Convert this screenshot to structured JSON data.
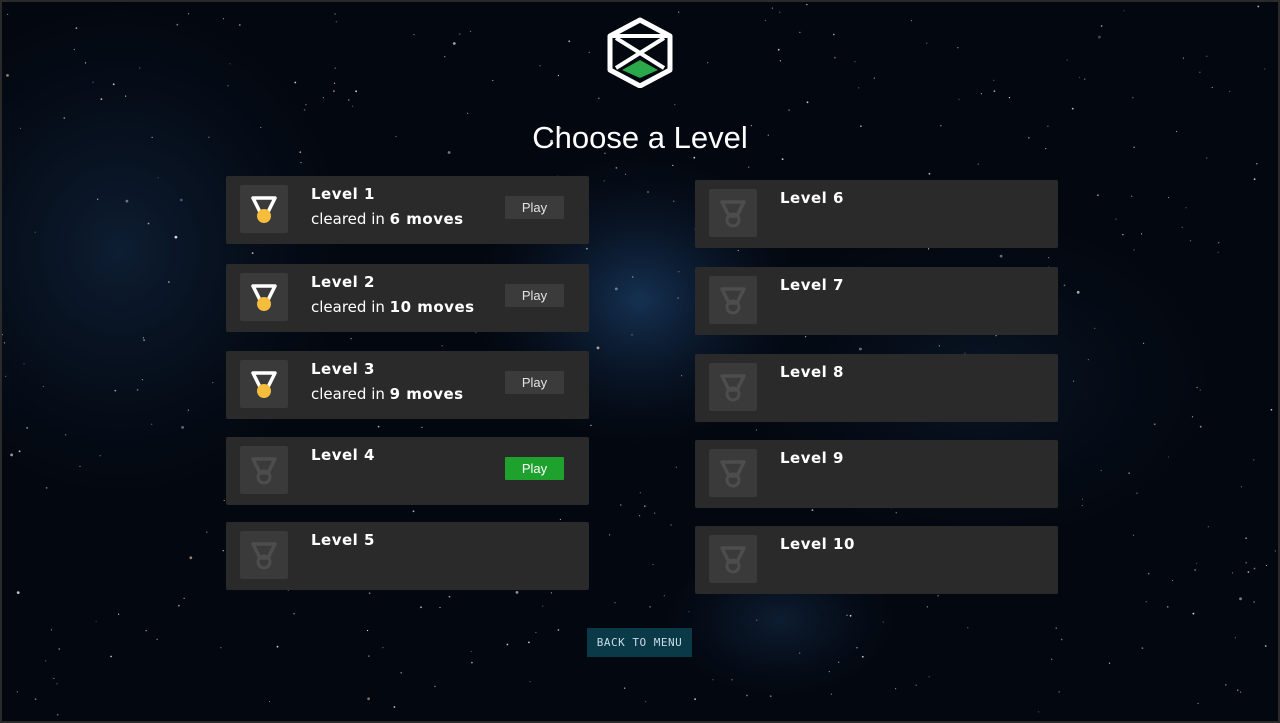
{
  "title": "Choose a Level",
  "back_button": "BACK TO MENU",
  "colors": {
    "accent_green": "#1ea22d",
    "medal_gold": "#f4bd3b",
    "card_bg": "#2a2a2a",
    "back_bg": "#0a3948"
  },
  "levels_left": [
    {
      "label": "Level 1",
      "sub_prefix": "cleared in ",
      "sub_moves": "6 moves",
      "play": "Play",
      "cleared": true,
      "active": false
    },
    {
      "label": "Level 2",
      "sub_prefix": "cleared in ",
      "sub_moves": "10 moves",
      "play": "Play",
      "cleared": true,
      "active": false
    },
    {
      "label": "Level 3",
      "sub_prefix": "cleared in ",
      "sub_moves": "9 moves",
      "play": "Play",
      "cleared": true,
      "active": false
    },
    {
      "label": "Level 4",
      "play": "Play",
      "cleared": false,
      "active": true
    },
    {
      "label": "Level 5",
      "cleared": false,
      "active": false
    }
  ],
  "levels_right": [
    {
      "label": "Level 6",
      "cleared": false
    },
    {
      "label": "Level 7",
      "cleared": false
    },
    {
      "label": "Level 8",
      "cleared": false
    },
    {
      "label": "Level 9",
      "cleared": false
    },
    {
      "label": "Level 10",
      "cleared": false
    }
  ]
}
